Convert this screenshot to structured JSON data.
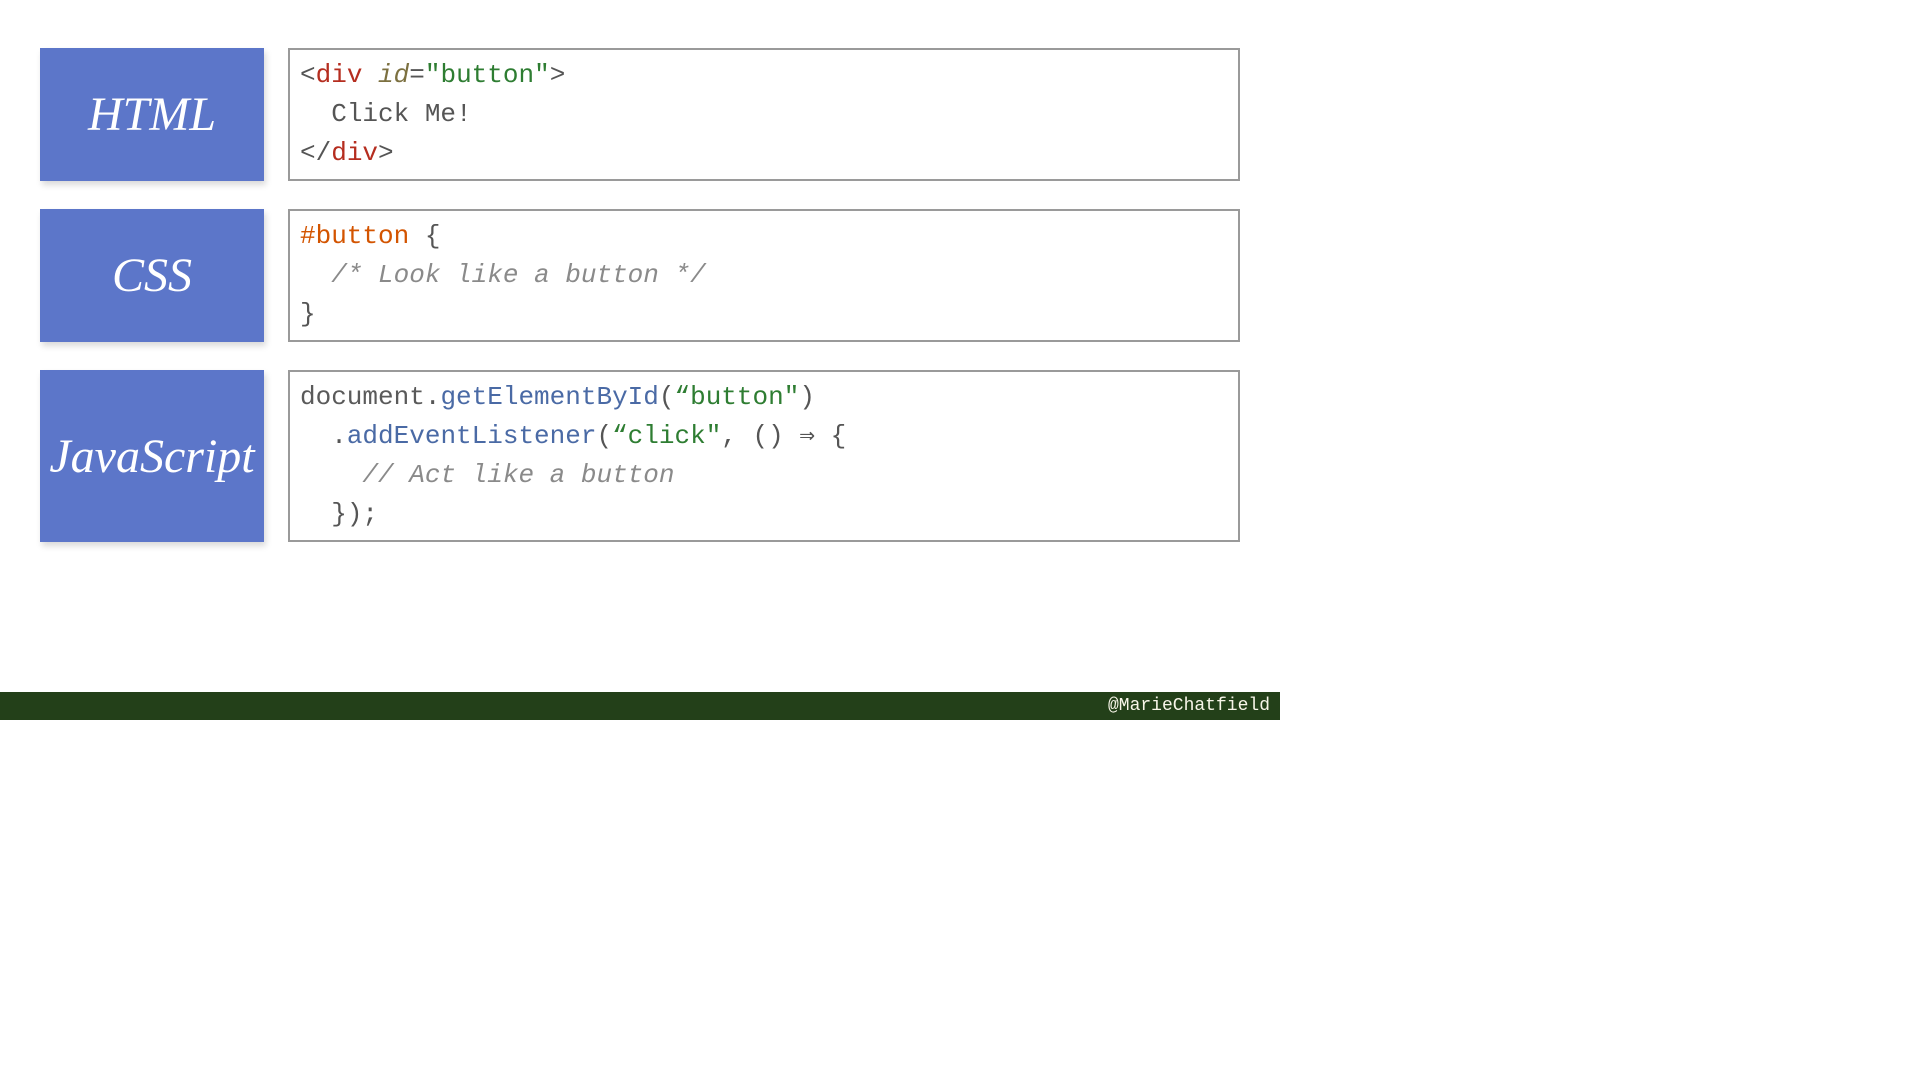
{
  "labels": {
    "html": "HTML",
    "css": "CSS",
    "js": "JavaScript"
  },
  "html_code": {
    "l1": {
      "open": "<",
      "tag": "div",
      "space": " ",
      "attr": "id",
      "eq": "=",
      "str": "\"button\"",
      "close": ">"
    },
    "l2": {
      "indent": "  ",
      "text": "Click Me!"
    },
    "l3": {
      "open": "</",
      "tag": "div",
      "close": ">"
    }
  },
  "css_code": {
    "l1": {
      "selector": "#button",
      "space": " ",
      "brace": "{"
    },
    "l2": {
      "indent": "  ",
      "comment": "/* Look like a button */"
    },
    "l3": {
      "brace": "}"
    }
  },
  "js_code": {
    "l1": {
      "obj": "document",
      "dot": ".",
      "method": "getElementById",
      "paren_open": "(",
      "arg": "“button\"",
      "paren_close": ")"
    },
    "l2": {
      "indent": "  ",
      "dot": ".",
      "method": "addEventListener",
      "paren_open": "(",
      "arg": "“click\"",
      "comma": ", ",
      "arrow": "() ⇒ {"
    },
    "l3": {
      "indent": "    ",
      "comment": "// Act like a button"
    },
    "l4": {
      "indent": "  ",
      "close": "});"
    }
  },
  "footer": "@MarieChatfield"
}
